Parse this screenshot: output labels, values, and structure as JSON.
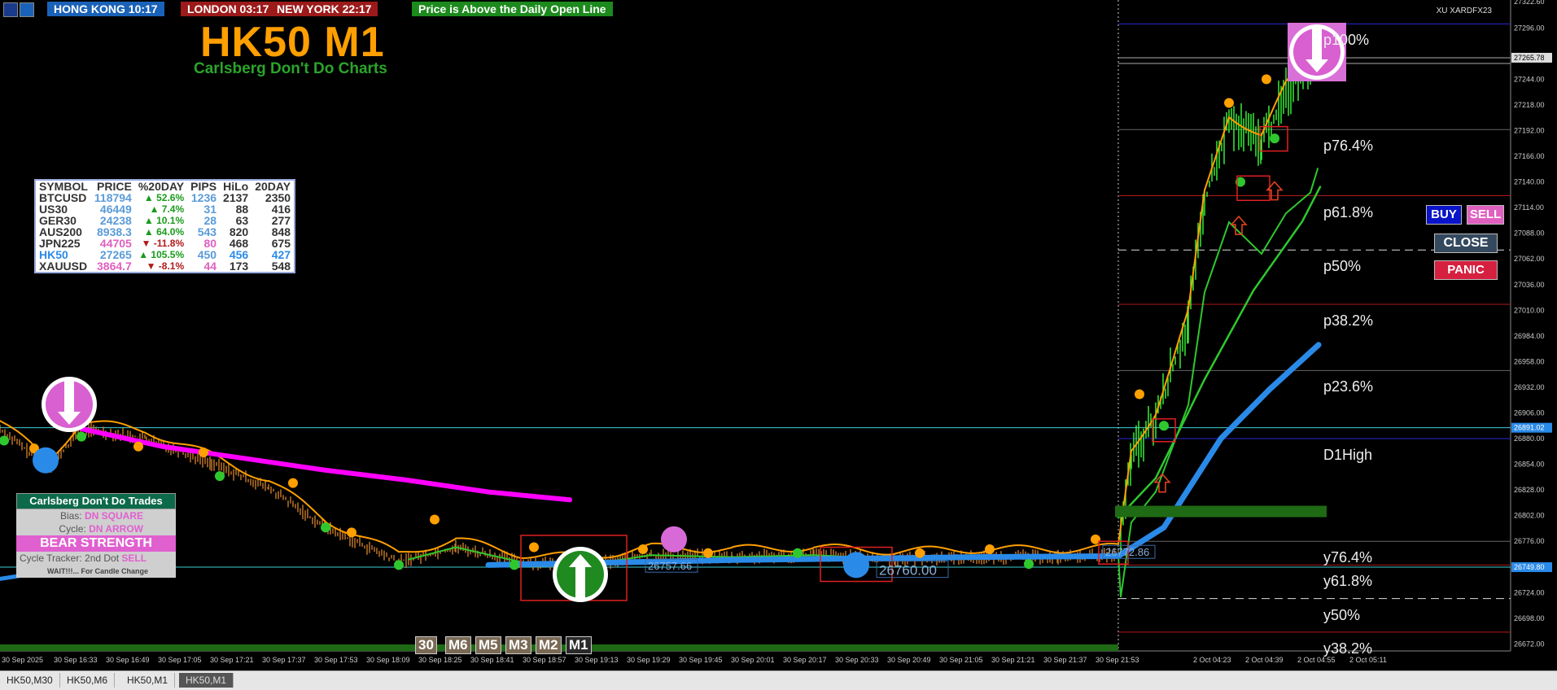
{
  "clocks": [
    {
      "label": "HONG KONG 10:17",
      "bg": "#1a62b8"
    },
    {
      "label": "LONDON 03:17",
      "bg": "#9c1a1a"
    },
    {
      "label": "NEW YORK 22:17",
      "bg": "#9c1a1a"
    }
  ],
  "price_notice": "Price is Above the Daily Open Line",
  "chart_title": "HK50 M1",
  "chart_subtitle": "Carlsberg Don't Do Charts",
  "broker_tag": "XU XARDFX23",
  "symbol_table": {
    "headers": [
      "SYMBOL",
      "PRICE",
      "%20DAY",
      "PIPS",
      "HiLo",
      "20DAY"
    ],
    "rows": [
      {
        "symbol": "BTCUSD",
        "price": "118794",
        "dir": "▲",
        "pct": "52.6%",
        "pips": "1236",
        "hilo": "2137",
        "d20": "2350",
        "price_color": "#5a9bd8",
        "pct_color": "#1a9a1a",
        "pips_color": "#5a9bd8"
      },
      {
        "symbol": "US30",
        "price": "46449",
        "dir": "▲",
        "pct": "7.4%",
        "pips": "31",
        "hilo": "88",
        "d20": "416",
        "price_color": "#5a9bd8",
        "pct_color": "#1a9a1a",
        "pips_color": "#5a9bd8"
      },
      {
        "symbol": "GER30",
        "price": "24238",
        "dir": "▲",
        "pct": "10.1%",
        "pips": "28",
        "hilo": "63",
        "d20": "277",
        "price_color": "#5a9bd8",
        "pct_color": "#1a9a1a",
        "pips_color": "#5a9bd8"
      },
      {
        "symbol": "AUS200",
        "price": "8938.3",
        "dir": "▲",
        "pct": "64.0%",
        "pips": "543",
        "hilo": "820",
        "d20": "848",
        "price_color": "#5a9bd8",
        "pct_color": "#1a9a1a",
        "pips_color": "#5a9bd8"
      },
      {
        "symbol": "JPN225",
        "price": "44705",
        "dir": "▼",
        "pct": "-11.8%",
        "pips": "80",
        "hilo": "468",
        "d20": "675",
        "price_color": "#e060c0",
        "pct_color": "#b01a1a",
        "pips_color": "#e060c0"
      },
      {
        "symbol": "HK50",
        "price": "27265",
        "dir": "▲",
        "pct": "105.5%",
        "pips": "450",
        "hilo": "456",
        "d20": "427",
        "price_color": "#5a9bd8",
        "pct_color": "#1a9a1a",
        "pips_color": "#5a9bd8",
        "highlight": true
      },
      {
        "symbol": "XAUUSD",
        "price": "3864.7",
        "dir": "▼",
        "pct": "-8.1%",
        "pips": "44",
        "hilo": "173",
        "d20": "548",
        "price_color": "#e060c0",
        "pct_color": "#b01a1a",
        "pips_color": "#e060c0"
      }
    ]
  },
  "trades_panel": {
    "header": "Carlsberg Don't Do Trades",
    "bias_label": "Bias:",
    "bias_value": "DN SQUARE",
    "cycle_label": "Cycle:",
    "cycle_value": "DN ARROW",
    "strength": "BEAR STRENGTH",
    "tracker_label": "Cycle Tracker: 2nd Dot",
    "tracker_value": "SELL",
    "wait_text": "WAIT!!!... For Candle Change"
  },
  "buttons": {
    "buy": "BUY",
    "sell": "SELL",
    "close": "CLOSE",
    "panic": "PANIC"
  },
  "timeframes": [
    "30",
    "M6",
    "M5",
    "M3",
    "M2",
    "M1"
  ],
  "tabs": [
    "HK50,M30",
    "HK50,M6",
    "HK50,M1",
    "HK50,M1"
  ],
  "fib_labels": [
    {
      "text": "p100%",
      "price": 27300
    },
    {
      "text": "p76.4%",
      "price": 27193
    },
    {
      "text": "p61.8%",
      "price": 27126
    },
    {
      "text": "p50%",
      "price": 27071
    },
    {
      "text": "p38.2%",
      "price": 27016
    },
    {
      "text": "p23.6%",
      "price": 26949
    },
    {
      "text": "D1High",
      "price": 26880
    },
    {
      "text": "y76.4%",
      "price": 26776
    },
    {
      "text": "y61.8%",
      "price": 26752
    },
    {
      "text": "y50%",
      "price": 26718
    },
    {
      "text": "y38.2%",
      "price": 26684
    }
  ],
  "price_tags": [
    {
      "text": "26757.66"
    },
    {
      "text": "26772.86"
    },
    {
      "text": "26760.00"
    }
  ],
  "chart_data": {
    "type": "line",
    "y_axis": [
      "27322.60",
      "27296.00",
      "27265.78",
      "27244.00",
      "27218.00",
      "27192.00",
      "27166.00",
      "27140.00",
      "27114.00",
      "27088.00",
      "27062.00",
      "27036.00",
      "27010.00",
      "26984.00",
      "26958.00",
      "26932.00",
      "26906.00",
      "26891.02",
      "26880.00",
      "26854.00",
      "26828.00",
      "26802.00",
      "26776.00",
      "26749.80",
      "26724.00",
      "26698.00",
      "26672.00"
    ],
    "x_axis": [
      "30 Sep 2025",
      "30 Sep 16:33",
      "30 Sep 16:49",
      "30 Sep 17:05",
      "30 Sep 17:21",
      "30 Sep 17:37",
      "30 Sep 17:53",
      "30 Sep 18:09",
      "30 Sep 18:25",
      "30 Sep 18:41",
      "30 Sep 18:57",
      "30 Sep 19:13",
      "30 Sep 19:29",
      "30 Sep 19:45",
      "30 Sep 20:01",
      "30 Sep 20:17",
      "30 Sep 20:33",
      "30 Sep 20:49",
      "30 Sep 21:05",
      "30 Sep 21:21",
      "30 Sep 21:37",
      "30 Sep 21:53",
      "2 Oct 04:23",
      "2 Oct 04:39",
      "2 Oct 04:55",
      "2 Oct 05:11"
    ],
    "current_price": "27265.78",
    "highlight_prices": [
      "26891.02",
      "26749.80"
    ],
    "colors": {
      "ema_fast": "#ff9f00",
      "ema_slow": "#2ec82e",
      "ma_blue": "#2a8ae8",
      "ma_magenta": "#ff00ff",
      "candles": "#3aff3a"
    }
  }
}
